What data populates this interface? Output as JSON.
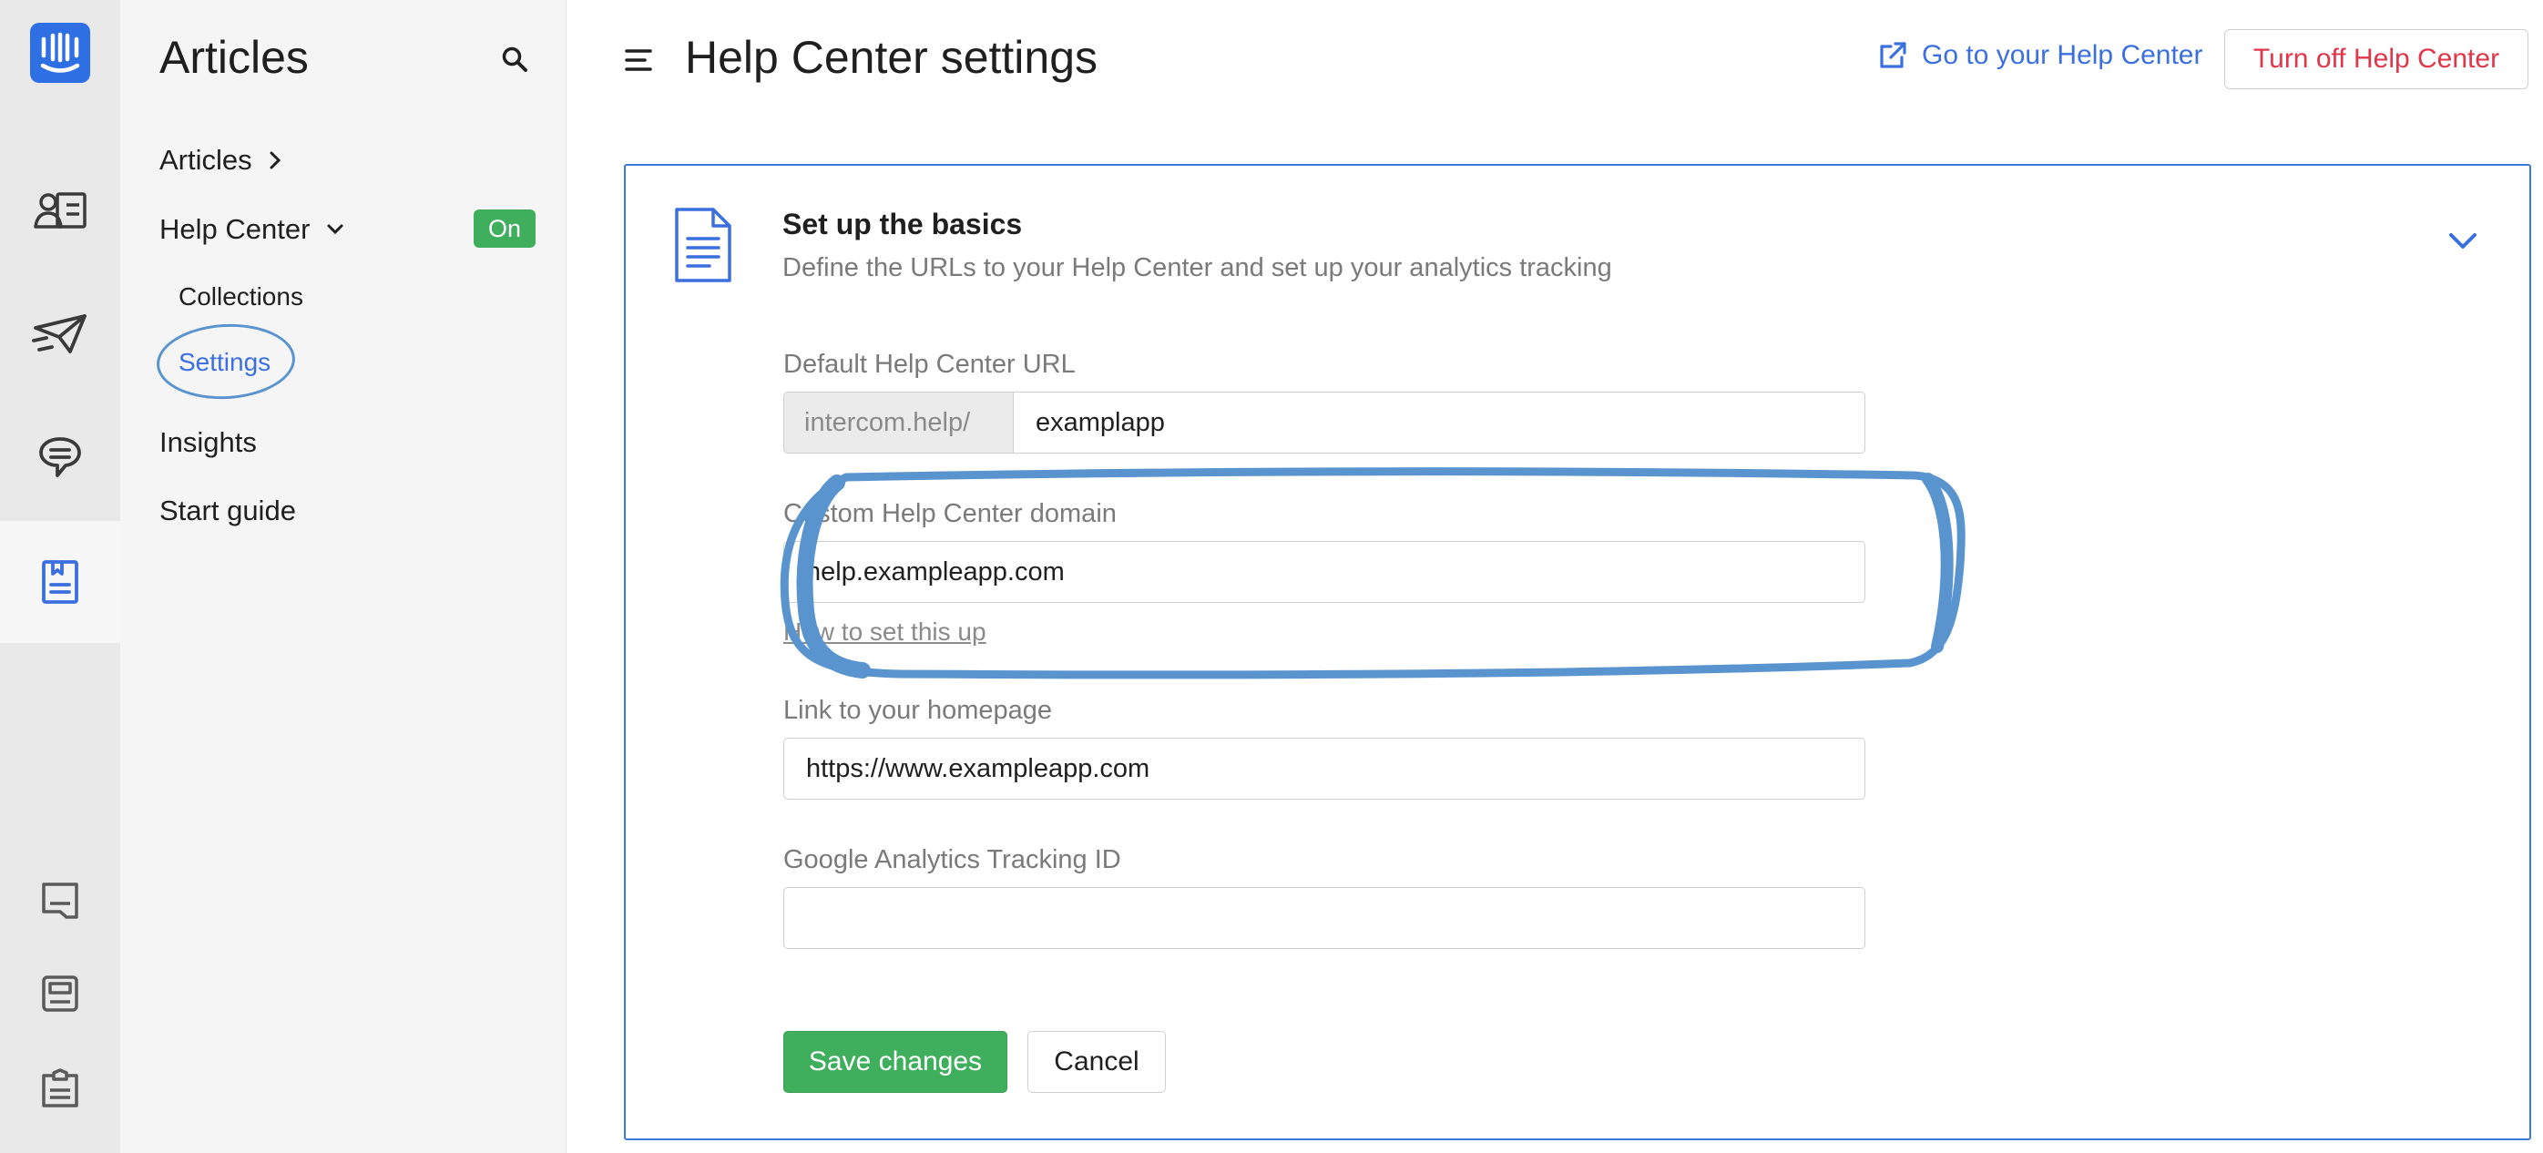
{
  "rail": {
    "items": [
      {
        "icon": "intercom-logo-icon"
      },
      {
        "icon": "contacts-icon"
      },
      {
        "icon": "outbound-send-icon"
      },
      {
        "icon": "messages-icon"
      },
      {
        "icon": "articles-icon",
        "active": true
      },
      {
        "icon": "inbox-icon"
      },
      {
        "icon": "reports-icon"
      },
      {
        "icon": "clipboard-icon"
      }
    ]
  },
  "sidebar": {
    "title": "Articles",
    "items": [
      {
        "label": "Articles"
      },
      {
        "label": "Help Center",
        "badge": "On"
      },
      {
        "label": "Collections"
      },
      {
        "label": "Settings"
      },
      {
        "label": "Insights"
      },
      {
        "label": "Start guide"
      }
    ]
  },
  "header": {
    "title": "Help Center settings",
    "go_link": "Go to your Help Center",
    "turn_off": "Turn off Help Center"
  },
  "card": {
    "title": "Set up the basics",
    "subtitle": "Define the URLs to your Help Center and set up your analytics tracking",
    "fields": {
      "default_url": {
        "label": "Default Help Center URL",
        "prefix": "intercom.help/",
        "value": "examplapp"
      },
      "custom_domain": {
        "label": "Custom Help Center domain",
        "value": "help.exampleapp.com",
        "help_link": "How to set this up"
      },
      "homepage": {
        "label": "Link to your homepage",
        "value": "https://www.exampleapp.com"
      },
      "analytics": {
        "label": "Google Analytics Tracking ID",
        "value": ""
      }
    },
    "save_label": "Save changes",
    "cancel_label": "Cancel"
  },
  "colors": {
    "accent": "#3b6fe0",
    "success": "#3fae5d",
    "danger": "#e0364a",
    "annotation": "#5a94cf"
  }
}
